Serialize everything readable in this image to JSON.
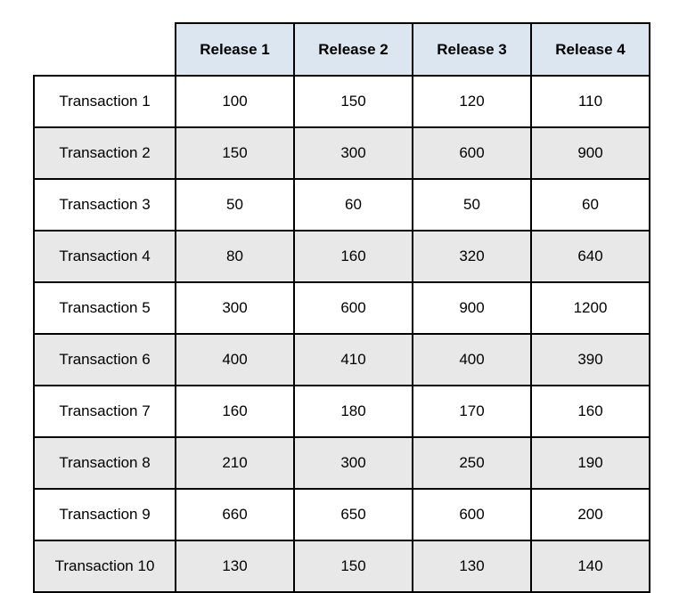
{
  "table": {
    "corner_label": "",
    "column_headers": [
      "Release 1",
      "Release 2",
      "Release 3",
      "Release 4"
    ],
    "row_headers": [
      "Transaction 1",
      "Transaction 2",
      "Transaction 3",
      "Transaction 4",
      "Transaction 5",
      "Transaction 6",
      "Transaction 7",
      "Transaction 8",
      "Transaction 9",
      "Transaction 10"
    ],
    "rows": [
      {
        "label": "Transaction 1",
        "values": [
          "100",
          "150",
          "120",
          "110"
        ],
        "shaded": false
      },
      {
        "label": "Transaction 2",
        "values": [
          "150",
          "300",
          "600",
          "900"
        ],
        "shaded": true
      },
      {
        "label": "Transaction 3",
        "values": [
          "50",
          "60",
          "50",
          "60"
        ],
        "shaded": false
      },
      {
        "label": "Transaction 4",
        "values": [
          "80",
          "160",
          "320",
          "640"
        ],
        "shaded": true
      },
      {
        "label": "Transaction 5",
        "values": [
          "300",
          "600",
          "900",
          "1200"
        ],
        "shaded": false
      },
      {
        "label": "Transaction 6",
        "values": [
          "400",
          "410",
          "400",
          "390"
        ],
        "shaded": true
      },
      {
        "label": "Transaction 7",
        "values": [
          "160",
          "180",
          "170",
          "160"
        ],
        "shaded": false
      },
      {
        "label": "Transaction 8",
        "values": [
          "210",
          "300",
          "250",
          "190"
        ],
        "shaded": true
      },
      {
        "label": "Transaction 9",
        "values": [
          "660",
          "650",
          "600",
          "200"
        ],
        "shaded": false
      },
      {
        "label": "Transaction 10",
        "values": [
          "130",
          "150",
          "130",
          "140"
        ],
        "shaded": true
      }
    ],
    "colors": {
      "header_background": "#dce6f1",
      "shaded_row_background": "#e8e8e8",
      "plain_row_background": "#ffffff",
      "border": "#000000",
      "text": "#000000"
    }
  },
  "chart_data": {
    "type": "table",
    "title": "",
    "categories": [
      "Release 1",
      "Release 2",
      "Release 3",
      "Release 4"
    ],
    "series": [
      {
        "name": "Transaction 1",
        "values": [
          100,
          150,
          120,
          110
        ]
      },
      {
        "name": "Transaction 2",
        "values": [
          150,
          300,
          600,
          900
        ]
      },
      {
        "name": "Transaction 3",
        "values": [
          50,
          60,
          50,
          60
        ]
      },
      {
        "name": "Transaction 4",
        "values": [
          80,
          160,
          320,
          640
        ]
      },
      {
        "name": "Transaction 5",
        "values": [
          300,
          600,
          900,
          1200
        ]
      },
      {
        "name": "Transaction 6",
        "values": [
          400,
          410,
          400,
          390
        ]
      },
      {
        "name": "Transaction 7",
        "values": [
          160,
          180,
          170,
          160
        ]
      },
      {
        "name": "Transaction 8",
        "values": [
          210,
          300,
          250,
          190
        ]
      },
      {
        "name": "Transaction 9",
        "values": [
          660,
          650,
          600,
          200
        ]
      },
      {
        "name": "Transaction 10",
        "values": [
          130,
          150,
          130,
          140
        ]
      }
    ],
    "xlabel": "",
    "ylabel": "",
    "grid": true,
    "legend": "none"
  }
}
